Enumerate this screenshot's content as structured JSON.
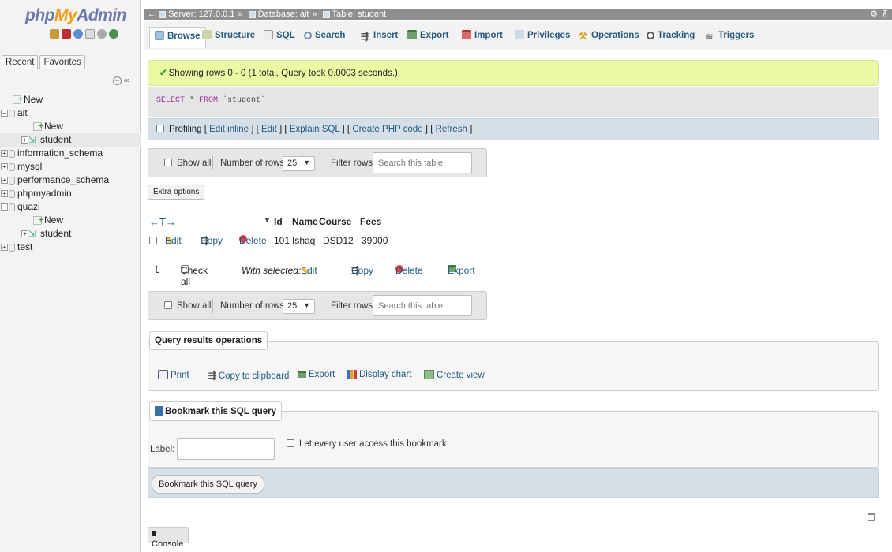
{
  "nav": {
    "logo": {
      "php": "php",
      "my": "My",
      "admin": "Admin"
    },
    "recent_label": "Recent",
    "favorites_label": "Favorites",
    "tree": [
      {
        "label": "New",
        "type": "new"
      },
      {
        "label": "ait",
        "type": "db"
      },
      {
        "label": "New",
        "type": "new"
      },
      {
        "label": "student",
        "type": "table"
      },
      {
        "label": "information_schema",
        "type": "db"
      },
      {
        "label": "mysql",
        "type": "db"
      },
      {
        "label": "performance_schema",
        "type": "db"
      },
      {
        "label": "phpmyadmin",
        "type": "db"
      },
      {
        "label": "quazi",
        "type": "db"
      },
      {
        "label": "New",
        "type": "new"
      },
      {
        "label": "student",
        "type": "table"
      },
      {
        "label": "test",
        "type": "db"
      }
    ]
  },
  "breadcrumb": {
    "server": "Server: 127.0.0.1",
    "database": "Database: ait",
    "table": "Table: student"
  },
  "tabs": [
    "Browse",
    "Structure",
    "SQL",
    "Search",
    "Insert",
    "Export",
    "Import",
    "Privileges",
    "Operations",
    "Tracking",
    "Triggers"
  ],
  "message": "Showing rows 0 - 0 (1 total, Query took 0.0003 seconds.)",
  "sql": {
    "select": "SELECT",
    "star": " * ",
    "from": "FROM",
    "table": " `student`"
  },
  "profiling": {
    "label": "Profiling",
    "links": [
      "Edit inline",
      "Edit",
      "Explain SQL",
      "Create PHP code",
      "Refresh"
    ]
  },
  "navbar": {
    "show_all": "Show all",
    "num_rows_label": "Number of rows:",
    "num_rows_value": "25",
    "filter_label": "Filter rows:",
    "filter_placeholder": "Search this table"
  },
  "extra_options": "Extra options",
  "results": {
    "columns": [
      "Id",
      "Name",
      "Course",
      "Fees"
    ],
    "rows": [
      {
        "Id": "101",
        "Name": "Ishaq",
        "Course": "DSD12",
        "Fees": "39000"
      }
    ],
    "row_actions": {
      "edit": "Edit",
      "copy": "Copy",
      "delete": "Delete"
    }
  },
  "with_selected": {
    "check_all": "Check all",
    "label": "With selected:",
    "edit": "Edit",
    "copy": "Copy",
    "delete": "Delete",
    "export": "Export"
  },
  "query_ops": {
    "title": "Query results operations",
    "items": [
      "Print",
      "Copy to clipboard",
      "Export",
      "Display chart",
      "Create view"
    ]
  },
  "bookmark": {
    "title": "Bookmark this SQL query",
    "label": "Label:",
    "label_value": "",
    "share": "Let every user access this bookmark",
    "button": "Bookmark this SQL query"
  },
  "console": "Console",
  "colors": {
    "accent": "#235a81",
    "message_bg": "#ebf8a4",
    "breadcrumb_bg": "#8f8f8f"
  }
}
